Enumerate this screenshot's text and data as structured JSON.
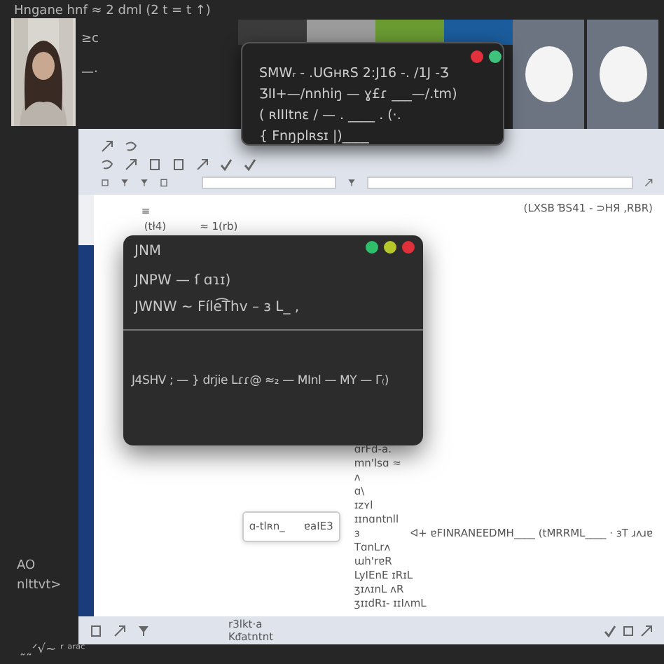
{
  "desktop_caption": "Hngane hnf ≈ 2 dml  (2 t = t ↑)",
  "side_labels": [
    "≥c",
    "—·"
  ],
  "color_strip": [
    {
      "color": "#3b3b3b"
    },
    {
      "color": "#9b9b9b"
    },
    {
      "color": "#6a9a32"
    },
    {
      "color": "#1b5c9c"
    }
  ],
  "top_popup": {
    "controls": [
      {
        "color": "#e2303c"
      },
      {
        "color": "#3ec27c"
      }
    ],
    "lines": [
      "SMWᵣ - .UGʜʀS 2:J16 -.   /1J -Ʒ",
      "ƷII+—/nnhiŋ — ɣ£ɾ ___—/.tm)",
      "( ʀIIItnɛ / — . ____ . (·.",
      "{ Fnŋplʀsɪ |)____"
    ]
  },
  "editor": {
    "header_left": [
      "≡",
      "(tł4)",
      "≈ 1(rb)"
    ],
    "header_note": "(LXSB ƁS41 - ⊃HЯ ,RBR)",
    "field_texts": [
      "ɑ-tlʀn_",
      "ɐaIE3"
    ],
    "list": [
      "ɑrFd-a.",
      "mn'lsɑ ≈",
      "ʌ",
      "ɑ\\",
      "ɪzʏl",
      "ɪɪnɑntnll",
      "ɜ",
      "TɑnLrʌ",
      "ɯh'rɐR",
      "LyIEnE ɪRɪL",
      "ʒɪʌɪnL ʌR",
      "ʒɪɪdRɪ- ɪɪIʌmL"
    ],
    "list_extra": "ᐊ+ ɐFINRANEEDMH____ (tMRRML____ · ɜT ɹʌɹɐ",
    "footer_texts": [
      "r3lkt·a",
      "Kᵭatntnt"
    ]
  },
  "dark_window": {
    "title": "JNM",
    "controls": [
      {
        "color": "#2fbf6a"
      },
      {
        "color": "#b6c62a"
      },
      {
        "color": "#e0303a"
      }
    ],
    "lines": [
      "JNPW — ſ ɑɿɪ)",
      "JWNW ~ Fíle͡Thv – ɜ ᒪ_ ,"
    ],
    "body": "J4SHV ; — } drjie Lɾɾ@ ≈₂ — MInl — MY — Γ₍)"
  },
  "left_labels": [
    "AO",
    "nlttvt>"
  ],
  "signature": "˷˷ᐟ√~ ʳ ᵃʳᵃᶜ"
}
